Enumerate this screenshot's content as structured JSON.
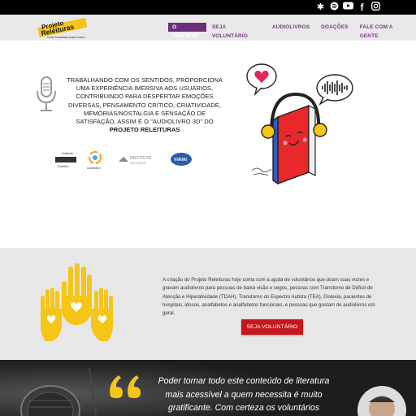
{
  "social": [
    "yelp-icon",
    "spotify-icon",
    "youtube-icon",
    "facebook-icon",
    "instagram-icon"
  ],
  "logo": {
    "line1": "Projeto",
    "line2": "Releituras",
    "tagline": "LIVRO ACESSÍVEL PARA TODOS"
  },
  "nav": [
    {
      "label": "O PROJETO",
      "active": true
    },
    {
      "label": "SEJA VOLUNTÁRIO",
      "active": false
    },
    {
      "label": "AUDIOLIVROS",
      "active": false
    },
    {
      "label": "DOAÇÕES",
      "active": false
    },
    {
      "label": "FALE COM A GENTE",
      "active": false
    }
  ],
  "widgets": {
    "contrast": "◐",
    "font": "тT"
  },
  "hero": {
    "text_plain": "TRABALHANDO COM OS SENTIDOS, PROPORCIONA UMA EXPERIÊNCIA IMERSIVA AOS USUÁRIOS, CONTRIBUINDO PARA DESPERTAR EMOÇÕES DIVERSAS, PENSAMENTO CRÍTICO, CRIATIVIDADE, MEMÓRIAS/NOSTALGIA E SENSAÇÃO DE SATISFAÇÃO, ASSIM É O \"AUDIOLIVRO 3D\" DO",
    "text_bold": "PROJETO RELEITURAS"
  },
  "partners": {
    "p1_line1": "Instituto",
    "p1_line2": "Ruanteo",
    "p2": "cocreation",
    "p3_line1": "INSTITUTO",
    "p3_line2": "NEXXERA",
    "p4": "VIAVAI"
  },
  "volunteer": {
    "text": "A criação do Projeto Releituras hoje conta com a ajuda de voluntários que doam suas vozes e gravam audiolivros para pessoas de baixa visão e cegos, pessoas com Transtorno de Déficit de Atenção e Hiperatividade (TDAH), Transtorno do Espectro Autista (TEA), Dislexia, pacientes de hospitais, idosos, analfabetos e analfabetos funcionais, e pessoas que gostam de audiolivros em geral.",
    "button": "SEJA VOLUNTÁRIO"
  },
  "quote": {
    "text": "Poder tornar todo este conteúdo de literatura mais acessível a quem necessita é muito gratificante. Com certeza os voluntários"
  },
  "colors": {
    "purple": "#6b2f7a",
    "red": "#c4161c",
    "yellow": "#f5c518"
  }
}
